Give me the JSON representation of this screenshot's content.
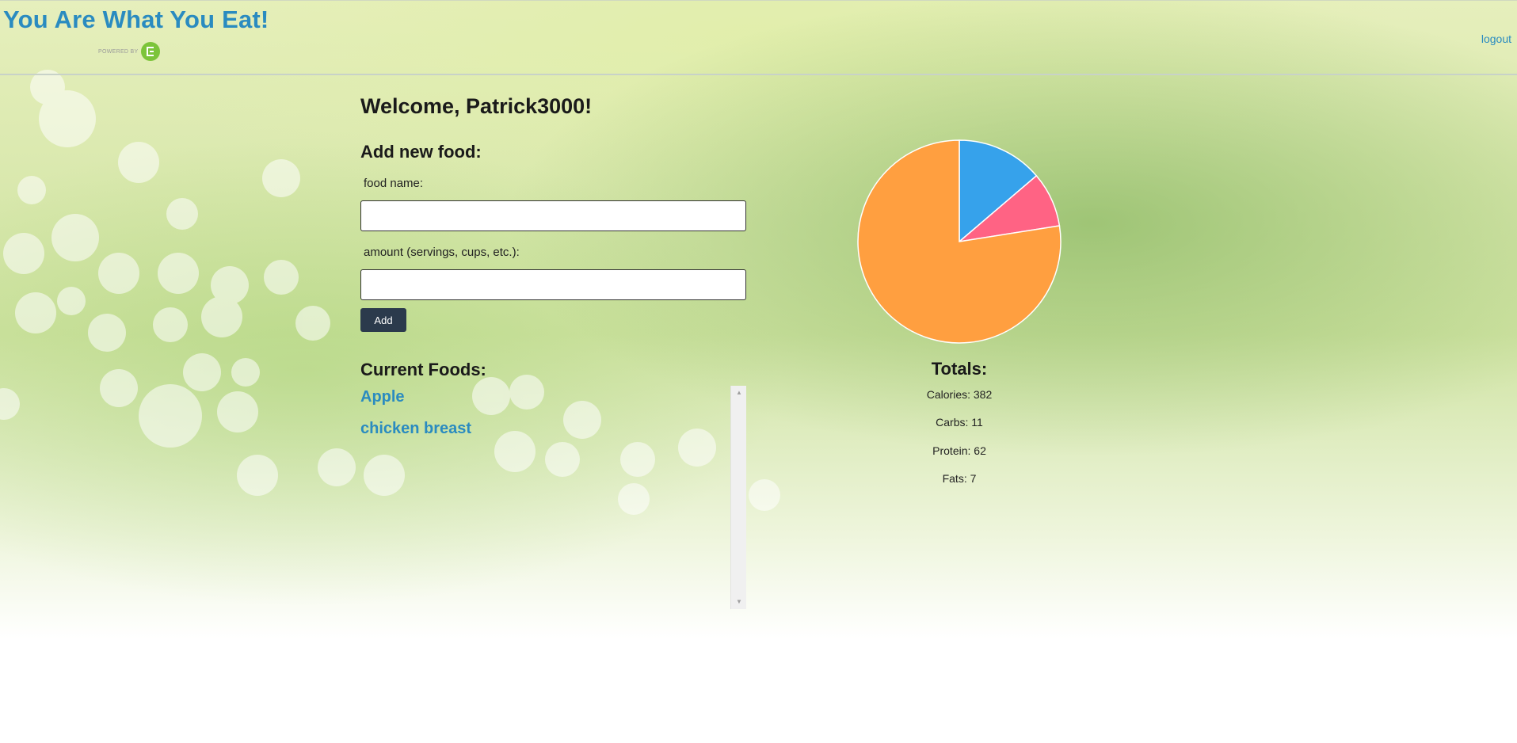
{
  "header": {
    "title": "You Are What You Eat!",
    "powered_by": "POWERED BY",
    "logout_label": "logout"
  },
  "main": {
    "welcome": "Welcome, Patrick3000!",
    "add_food": {
      "heading": "Add new food:",
      "food_name_label": "food name:",
      "food_name_value": "",
      "amount_label": "amount (servings, cups, etc.):",
      "amount_value": "",
      "add_button_label": "Add"
    },
    "current_foods": {
      "heading": "Current Foods:",
      "items": [
        "Apple",
        "chicken breast"
      ]
    },
    "totals": {
      "heading": "Totals:",
      "calories": "Calories: 382",
      "carbs": "Carbs: 11",
      "protein": "Protein: 62",
      "fats": "Fats: 7"
    }
  },
  "chart_data": {
    "type": "pie",
    "values": [
      11,
      7,
      62
    ],
    "colors": [
      "#36a2eb",
      "#ff6384",
      "#ff9f40"
    ]
  },
  "colors": {
    "brand": "#2a8bc0",
    "button": "#2b3a4c",
    "powered_logo": "#7cc43a"
  }
}
